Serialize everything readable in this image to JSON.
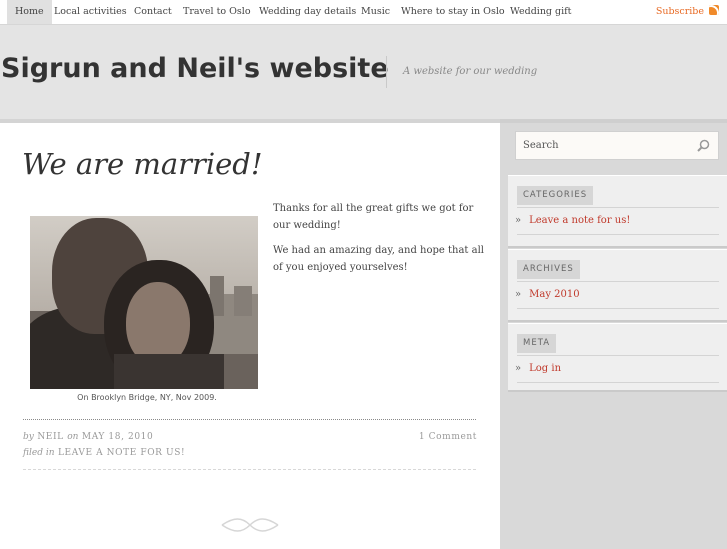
{
  "nav": {
    "items": [
      "Home",
      "Local activities",
      "Contact",
      "Travel to Oslo",
      "Wedding day details",
      "Music",
      "Where to stay in Oslo",
      "Wedding gift"
    ],
    "subscribe": "Subscribe"
  },
  "site": {
    "title": "Sigrun and Neil's website",
    "tagline": "A website for our wedding"
  },
  "post": {
    "title": "We are married!",
    "caption": "On Brooklyn Bridge, NY, Nov 2009.",
    "paragraph1": "Thanks for all the great gifts we got for our wedding!",
    "paragraph2": "We had an amazing day, and hope that all of you enjoyed yourselves!",
    "meta": {
      "by": "by",
      "author": "Neil",
      "on": "on",
      "date": "May 18, 2010",
      "comments": "1 Comment",
      "filed_in": "filed in",
      "category": "Leave a note for us!"
    }
  },
  "sidebar": {
    "search_placeholder": "Search",
    "widgets": [
      {
        "title": "CATEGORIES",
        "link": "Leave a note for us!"
      },
      {
        "title": "ARCHIVES",
        "link": "May 2010"
      },
      {
        "title": "META",
        "link": "Log in"
      }
    ],
    "bullet": "»"
  },
  "colors": {
    "accent_link": "#c0392b",
    "subscribe": "#e86a24"
  }
}
